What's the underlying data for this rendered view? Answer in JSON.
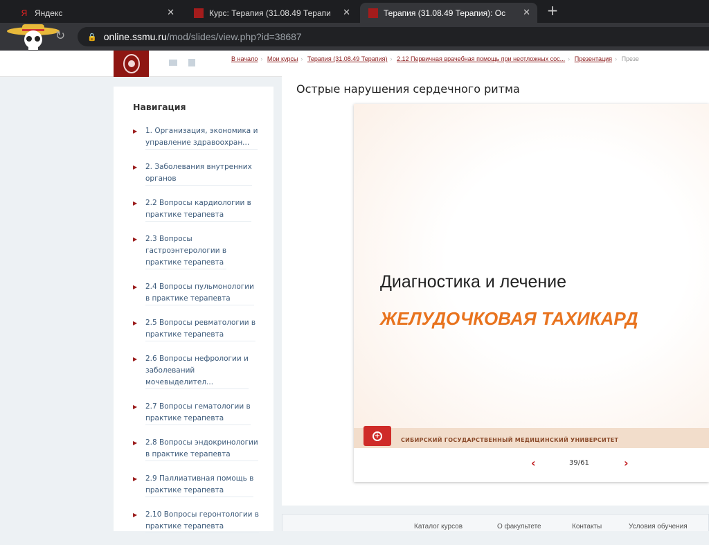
{
  "browser": {
    "tabs": [
      {
        "title": "Яндекс",
        "icon": "yandex-icon"
      },
      {
        "title": "Курс: Терапия (31.08.49 Терапи",
        "icon": "ssmu-icon"
      },
      {
        "title": "Терапия (31.08.49 Терапия): Ос",
        "icon": "ssmu-icon",
        "active": true
      }
    ],
    "new_tab": "+",
    "close": "✕",
    "url_host": "online.ssmu.ru",
    "url_path": "/mod/slides/view.php?id=38687"
  },
  "breadcrumbs": [
    "В начало",
    "Мои курсы",
    "Терапия (31.08.49 Терапия)",
    "2.12 Первичная врачебная помощь при неотложных сос...",
    "Презентация",
    "Презе"
  ],
  "sidebar": {
    "title": "Навигация",
    "items": [
      "1. Организация, экономика и\nуправление здравоохран...",
      "2. Заболевания внутренних\nорганов",
      "2.2 Вопросы кардиологии в\nпрактике терапевта",
      "2.3 Вопросы\nгастроэнтерологии в\nпрактике терапевта",
      "2.4 Вопросы пульмонологии\nв практике терапевта",
      "2.5 Вопросы ревматологии в\nпрактике терапевта",
      "2.6 Вопросы нефрологии и\nзаболеваний\nмочевыделител...",
      "2.7 Вопросы гематологии в\nпрактике терапевта",
      "2.8 Вопросы эндокринологии\nв практике терапевта",
      "2.9 Паллиативная помощь в\nпрактике терапевта",
      "2.10 Вопросы геронтологии в\nпрактике терапевта"
    ]
  },
  "main": {
    "title": "Острые нарушения сердечного ритма",
    "slide": {
      "line1": "Диагностика и лечение",
      "line2": "ЖЕЛУДОЧКОВАЯ ТАХИКАРД",
      "university": "СИБИРСКИЙ ГОСУДАРСТВЕННЫЙ МЕДИЦИНСКИЙ УНИВЕРСИТЕТ"
    },
    "pager": {
      "current": 39,
      "total": 61,
      "label": "39/61",
      "prev": "‹",
      "next": "›"
    }
  },
  "footer": [
    "Каталог курсов",
    "О факультете",
    "Контакты",
    "Условия обучения"
  ]
}
